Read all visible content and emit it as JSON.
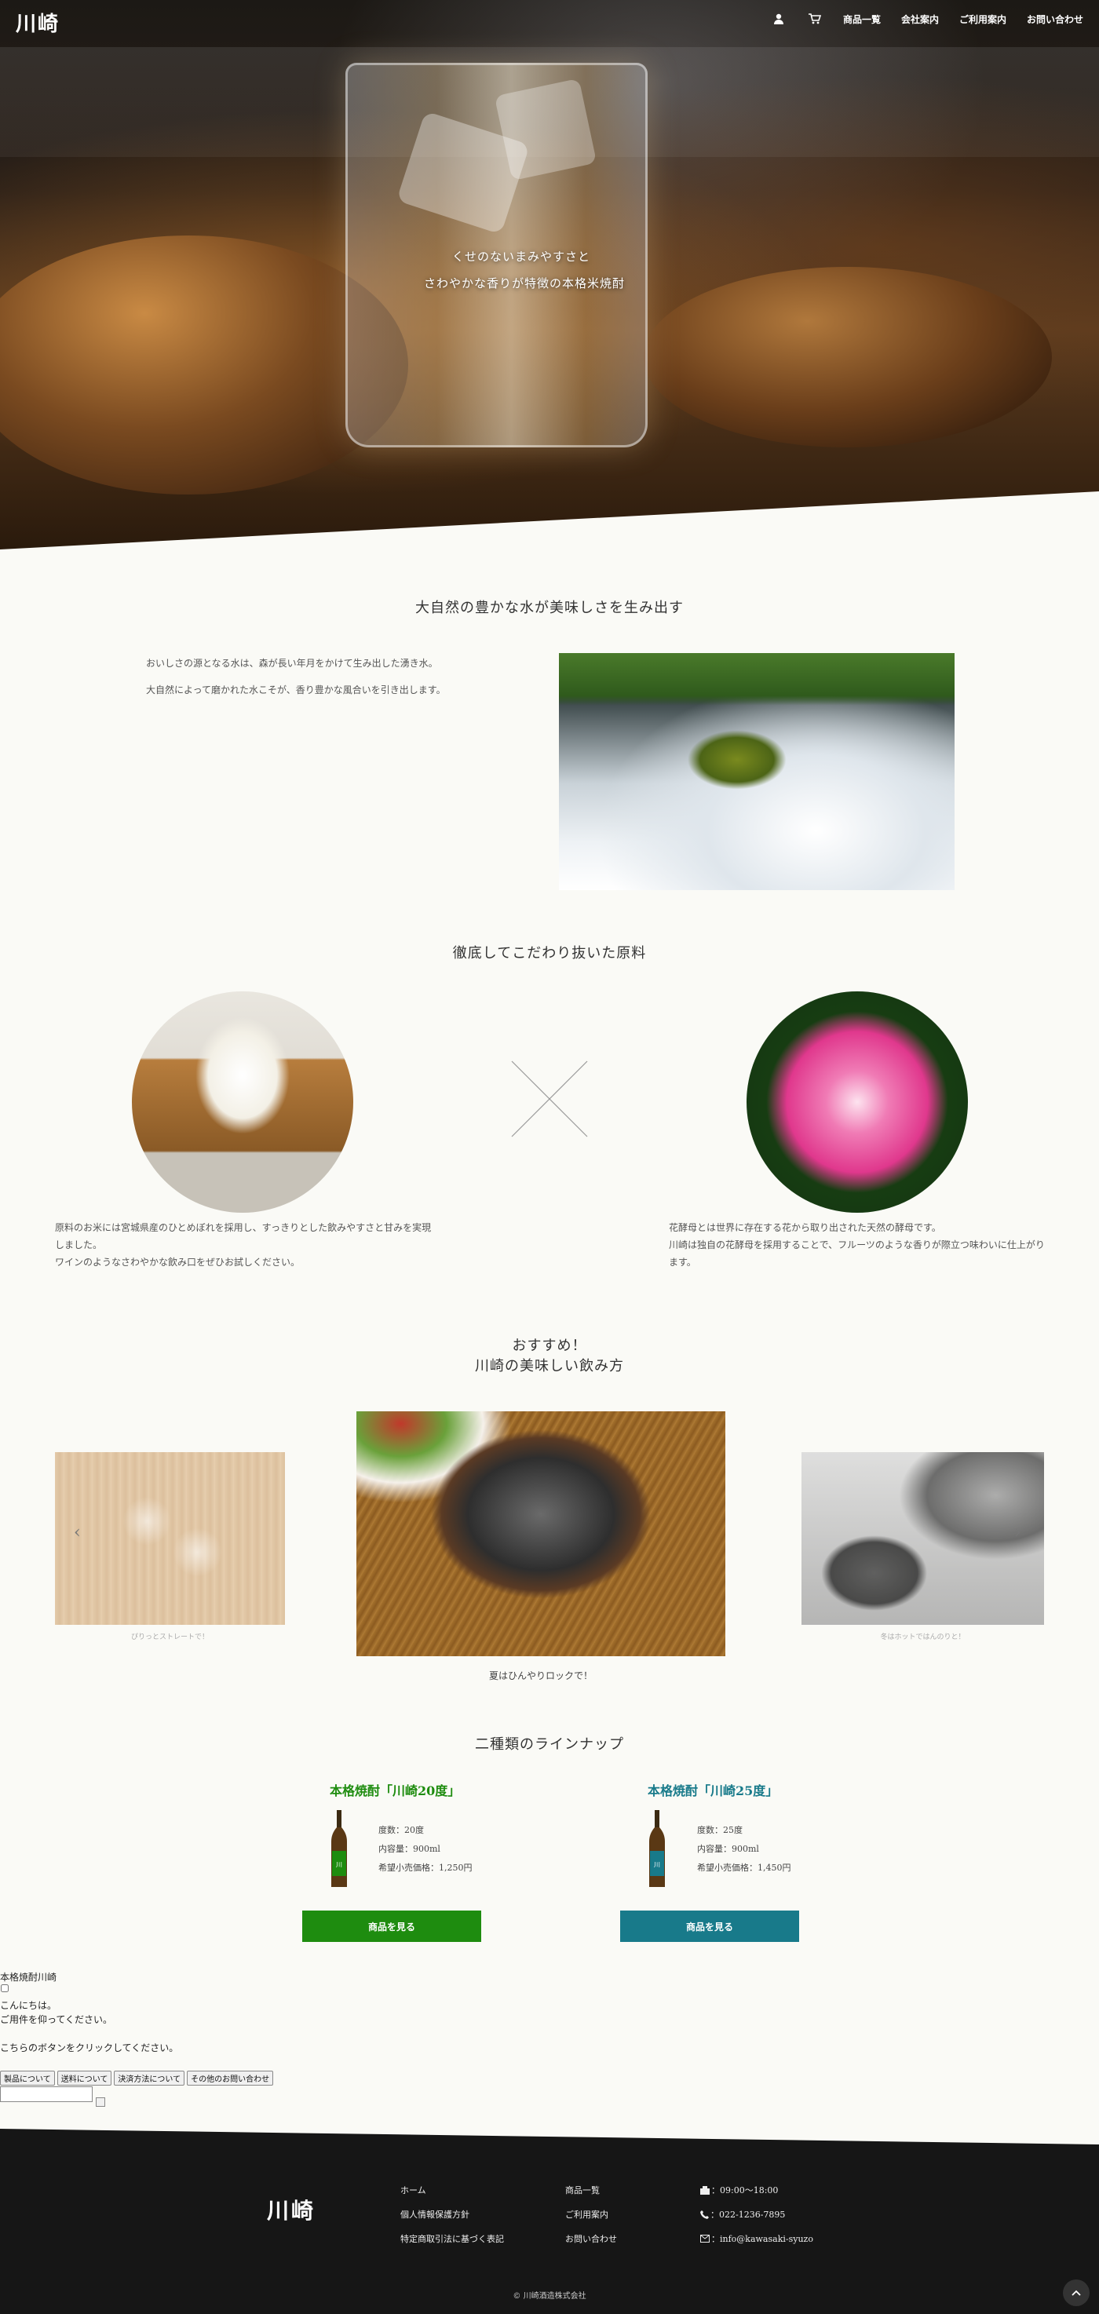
{
  "header": {
    "logo": "川崎",
    "nav": [
      "商品一覧",
      "会社案内",
      "ご利用案内",
      "お問い合わせ"
    ]
  },
  "hero": {
    "line1": "くせのないまみやすさと",
    "line2": "さわやかな香りが特徴の本格米焼酎"
  },
  "section1": {
    "title": "大自然の豊かな水が美味しさを生み出す",
    "p1": "おいしさの源となる水は、森が長い年月をかけて生み出した湧き水。",
    "p2": "大自然によって磨かれた水こそが、香り豊かな風合いを引き出します。"
  },
  "section2": {
    "title": "徹底してこだわり抜いた原料",
    "left_l1": "原料のお米には宮城県産のひとめぼれを採用し、すっきりとした飲みやすさと甘みを実現",
    "left_l2": "しました。",
    "left_l3": "ワインのようなさわやかな飲み口をぜひお試しください。",
    "right_l1": "花酵母とは世界に存在する花から取り出された天然の酵母です。",
    "right_l2": "川崎は独自の花酵母を採用することで、フルーツのような香りが際立つ味わいに仕上がり",
    "right_l3": "ます。"
  },
  "section3": {
    "title1": "おすすめ！",
    "title2": "川崎の美味しい飲み方",
    "cap_left": "ぴりっとストレートで！",
    "cap_center": "夏はひんやりロックで！",
    "cap_right": "冬はホットではんのりと！",
    "prev": "‹",
    "next": "›"
  },
  "section4": {
    "title": "二種類のラインナップ",
    "p1": {
      "name": "本格焼酎「川崎20度」",
      "spec1": "度数：20度",
      "spec2": "内容量：900ml",
      "spec3": "希望小売価格：1,250円",
      "button": "商品を見る",
      "color": "#1e8c0f"
    },
    "p2": {
      "name": "本格焼酎「川崎25度」",
      "spec1": "度数：25度",
      "spec2": "内容量：900ml",
      "spec3": "希望小売価格：1,450円",
      "button": "商品を見る",
      "color": "#187a8a"
    }
  },
  "chatbot": {
    "title": "本格焼酎川崎",
    "greet1": "こんにちは。",
    "greet2": "ご用件を仰ってください。",
    "prompt": "こちらのボタンをクリックしてください。",
    "buttons": [
      "製品について",
      "送料について",
      "決済方法について",
      "その他のお問い合わせ"
    ]
  },
  "footer": {
    "logo": "川崎",
    "col1": [
      "ホーム",
      "個人情報保護方針",
      "特定商取引法に基づく表記"
    ],
    "col2": [
      "商品一覧",
      "ご利用案内",
      "お問い合わせ"
    ],
    "hours": "：09:00～18:00",
    "phone": "：022-1236-7895",
    "email": "：info@kawasaki-syuzo",
    "copyright": "© 川崎酒造株式会社"
  }
}
